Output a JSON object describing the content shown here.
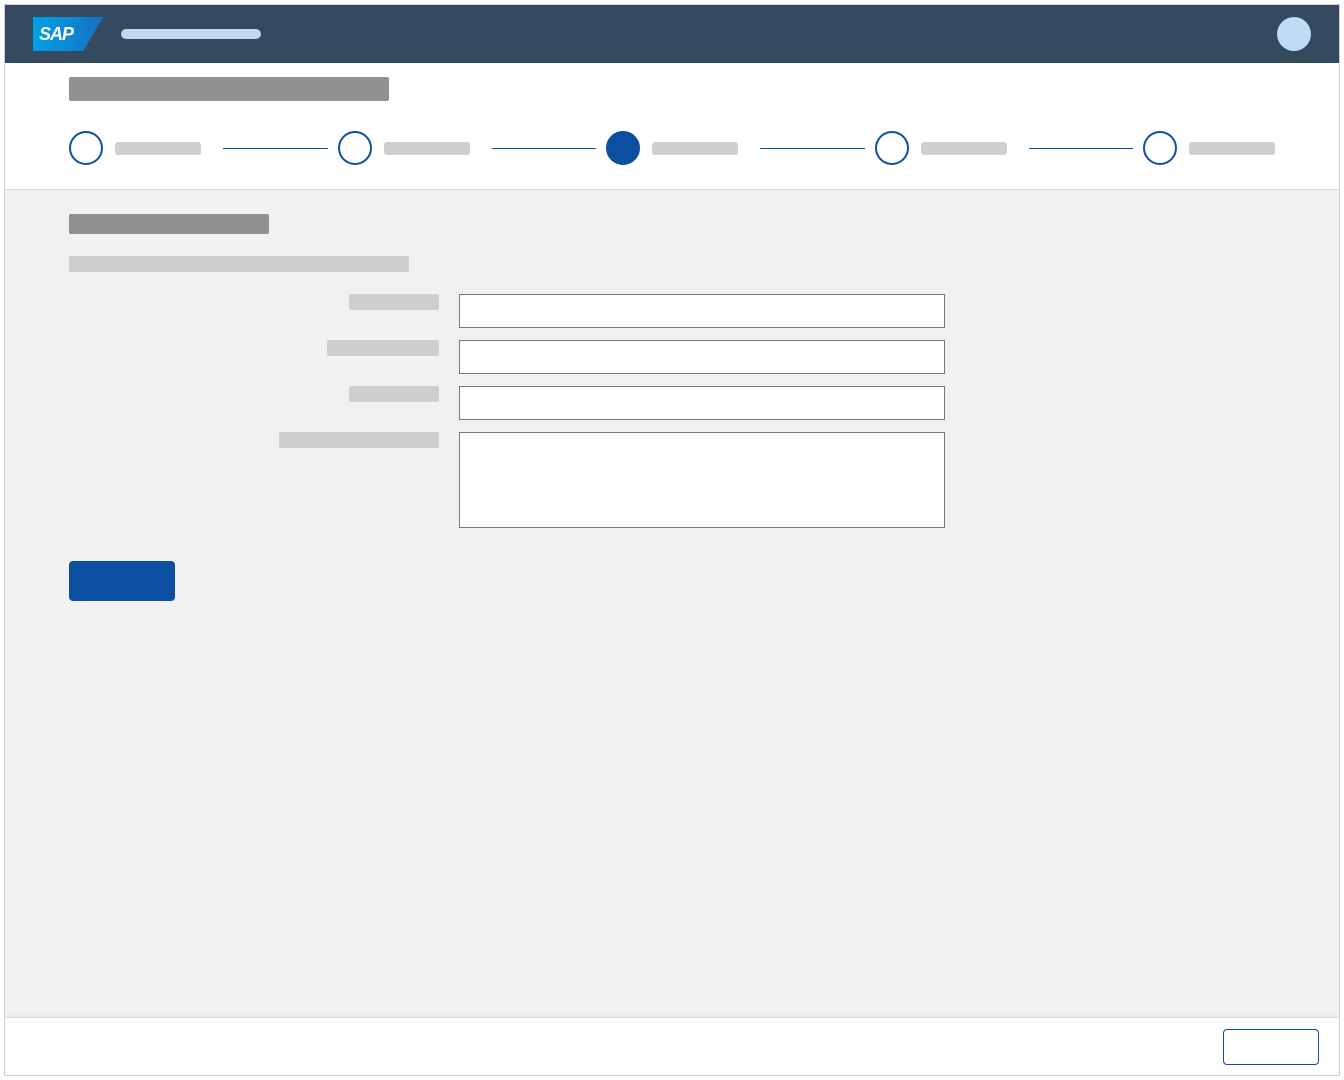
{
  "colors": {
    "shellbar": "#354a5f",
    "brand": "#0a4fa0",
    "skeleton_dark": "#919191",
    "skeleton_light": "#cfcfcf",
    "avatar": "#c0dcf5",
    "content_bg": "#f1f1f1"
  },
  "shell": {
    "logo_text": "SAP",
    "app_title": "",
    "avatar_initials": ""
  },
  "header": {
    "page_title": ""
  },
  "wizard": {
    "active_index": 2,
    "steps": [
      {
        "label": "",
        "state": "open"
      },
      {
        "label": "",
        "state": "open"
      },
      {
        "label": "",
        "state": "active"
      },
      {
        "label": "",
        "state": "open"
      },
      {
        "label": "",
        "state": "open"
      }
    ]
  },
  "section": {
    "title": "",
    "subtitle": ""
  },
  "form": {
    "fields": [
      {
        "label": "",
        "label_width": 90,
        "type": "text",
        "value": "",
        "placeholder": ""
      },
      {
        "label": "",
        "label_width": 112,
        "type": "text",
        "value": "",
        "placeholder": ""
      },
      {
        "label": "",
        "label_width": 90,
        "type": "text",
        "value": "",
        "placeholder": ""
      },
      {
        "label": "",
        "label_width": 160,
        "type": "textarea",
        "value": "",
        "placeholder": ""
      }
    ],
    "submit_label": ""
  },
  "footer": {
    "action_label": ""
  }
}
